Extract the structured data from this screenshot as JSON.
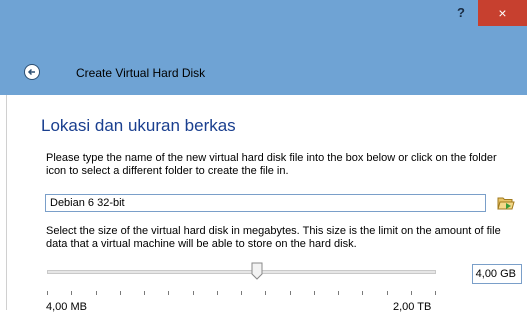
{
  "window": {
    "help_label": "?",
    "close_label": "×",
    "title": "Create Virtual Hard Disk"
  },
  "page": {
    "heading": "Lokasi dan ukuran berkas",
    "location_description": "Please type the name of the new virtual hard disk file into the box below or click on the folder icon to select a different folder to create the file in.",
    "filename_value": "Debian 6 32-bit",
    "size_description": "Select the size of the virtual hard disk in megabytes. This size is the limit on the amount of file data that a virtual machine will be able to store on the hard disk.",
    "size_value": "4,00 GB",
    "slider_min_label": "4,00 MB",
    "slider_max_label": "2,00 TB",
    "slider_fraction": 0.54
  },
  "icons": {
    "back": "back-arrow-icon",
    "folder": "folder-icon"
  }
}
